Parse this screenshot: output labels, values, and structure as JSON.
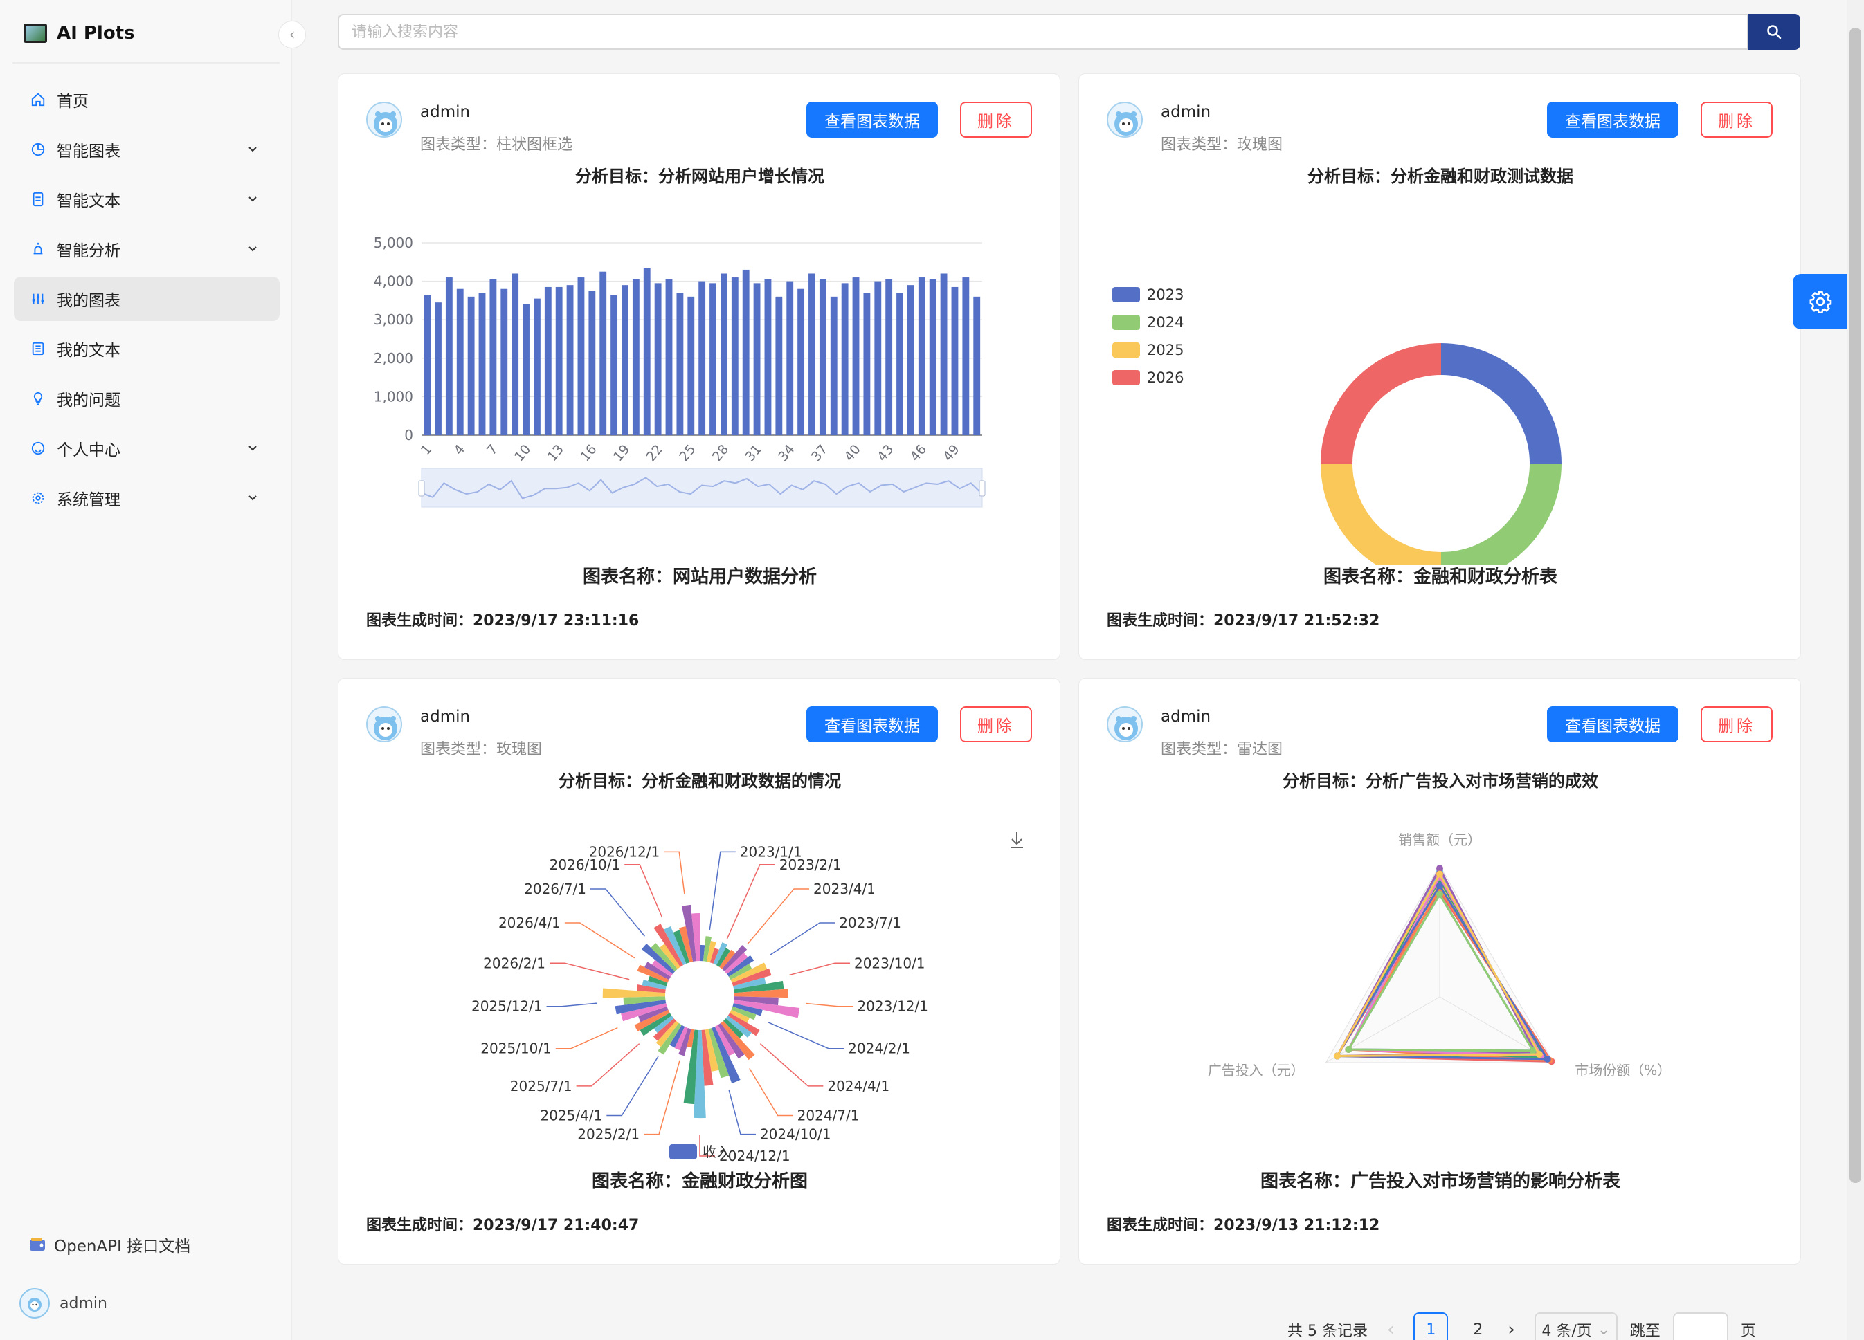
{
  "app": {
    "title": "AI Plots"
  },
  "sidebar": {
    "items": [
      {
        "label": "首页",
        "icon": "home-icon",
        "expandable": false,
        "active": false
      },
      {
        "label": "智能图表",
        "icon": "chart-pie-icon",
        "expandable": true,
        "active": false
      },
      {
        "label": "智能文本",
        "icon": "document-icon",
        "expandable": true,
        "active": false
      },
      {
        "label": "智能分析",
        "icon": "alarm-icon",
        "expandable": true,
        "active": false
      },
      {
        "label": "我的图表",
        "icon": "sliders-icon",
        "expandable": false,
        "active": true
      },
      {
        "label": "我的文本",
        "icon": "list-icon",
        "expandable": false,
        "active": false
      },
      {
        "label": "我的问题",
        "icon": "bulb-icon",
        "expandable": false,
        "active": false
      },
      {
        "label": "个人中心",
        "icon": "smile-icon",
        "expandable": true,
        "active": false
      },
      {
        "label": "系统管理",
        "icon": "gear-icon",
        "expandable": true,
        "active": false
      }
    ],
    "openapi_label": "OpenAPI 接口文档",
    "user": "admin"
  },
  "search": {
    "placeholder": "请输入搜索内容"
  },
  "cards": [
    {
      "user": "admin",
      "type": "图表类型：柱状图框选",
      "goal": "分析目标：分析网站用户增长情况",
      "view_label": "查看图表数据",
      "delete_label": "删除",
      "chart_name": "图表名称：网站用户数据分析",
      "time": "图表生成时间：2023/9/17 23:11:16"
    },
    {
      "user": "admin",
      "type": "图表类型：玫瑰图",
      "goal": "分析目标：分析金融和财政测试数据",
      "view_label": "查看图表数据",
      "delete_label": "删除",
      "chart_name": "图表名称：金融和财政分析表",
      "time": "图表生成时间：2023/9/17 21:52:32"
    },
    {
      "user": "admin",
      "type": "图表类型：玫瑰图",
      "goal": "分析目标：分析金融和财政数据的情况",
      "view_label": "查看图表数据",
      "delete_label": "删除",
      "chart_name": "图表名称：金融财政分析图",
      "time": "图表生成时间：2023/9/17 21:40:47"
    },
    {
      "user": "admin",
      "type": "图表类型：雷达图",
      "goal": "分析目标：分析广告投入对市场营销的成效",
      "view_label": "查看图表数据",
      "delete_label": "删除",
      "chart_name": "图表名称：广告投入对市场营销的影响分析表",
      "time": "图表生成时间：2023/9/13 21:12:12"
    }
  ],
  "pagination": {
    "total_label": "共 5 条记录",
    "pages": [
      "1",
      "2"
    ],
    "current": "1",
    "page_size": "4 条/页",
    "jump_label": "跳至",
    "page_suffix": "页"
  },
  "colors": {
    "primary": "#1677ff",
    "danger": "#ff4d4f",
    "search_button": "#1f3b87",
    "bar": "#5470c6"
  },
  "chart_data": [
    {
      "type": "bar",
      "x": [
        1,
        2,
        3,
        4,
        5,
        6,
        7,
        8,
        9,
        10,
        11,
        12,
        13,
        14,
        15,
        16,
        17,
        18,
        19,
        20,
        21,
        22,
        23,
        24,
        25,
        26,
        27,
        28,
        29,
        30,
        31,
        32,
        33,
        34,
        35,
        36,
        37,
        38,
        39,
        40,
        41,
        42,
        43,
        44,
        45,
        46,
        47,
        48,
        49,
        50
      ],
      "x_tick_labels": [
        "1",
        "4",
        "7",
        "10",
        "13",
        "16",
        "19",
        "22",
        "25",
        "28",
        "31",
        "34",
        "37",
        "40",
        "43",
        "46",
        "49"
      ],
      "values": [
        3650,
        3450,
        4100,
        3800,
        3600,
        3700,
        4050,
        3800,
        4200,
        3400,
        3550,
        3850,
        3850,
        3900,
        4100,
        3750,
        4250,
        3650,
        3900,
        4050,
        4350,
        3950,
        4050,
        3700,
        3600,
        4000,
        3950,
        4200,
        4100,
        4300,
        3950,
        4050,
        3600,
        4000,
        3800,
        4200,
        4050,
        3600,
        3950,
        4100,
        3700,
        4000,
        4050,
        3700,
        3900,
        4100,
        4050,
        4200,
        3850,
        4100,
        3600
      ],
      "yticks": [
        0,
        1000,
        2000,
        3000,
        4000,
        5000
      ],
      "ytick_labels": [
        "0",
        "1,000",
        "2,000",
        "3,000",
        "4,000",
        "5,000"
      ],
      "ylim": [
        0,
        5000
      ],
      "color": "#5470c6",
      "has_data_zoom": true
    },
    {
      "type": "pie",
      "variant": "donut",
      "legend": [
        "2023",
        "2024",
        "2025",
        "2026"
      ],
      "legend_position": "top-left",
      "values": [
        25,
        25,
        25,
        25
      ],
      "colors": [
        "#5470c6",
        "#91cc75",
        "#fac858",
        "#ee6666"
      ]
    },
    {
      "type": "pie",
      "variant": "rose",
      "legend": [
        "收入"
      ],
      "labels": [
        "2023/1/1",
        "2023/2/1",
        "2023/4/1",
        "2023/7/1",
        "2023/10/1",
        "2023/12/1",
        "2024/2/1",
        "2024/4/1",
        "2024/7/1",
        "2024/10/1",
        "2024/12/1",
        "2025/2/1",
        "2025/4/1",
        "2025/7/1",
        "2025/10/1",
        "2025/12/1",
        "2026/2/1",
        "2026/4/1",
        "2026/7/1",
        "2026/10/1",
        "2026/12/1"
      ],
      "values": [
        40,
        35,
        45,
        60,
        75,
        95,
        50,
        55,
        70,
        85,
        140,
        42,
        50,
        55,
        70,
        90,
        48,
        52,
        60,
        68,
        90
      ],
      "colors": [
        "#5470c6",
        "#91cc75",
        "#fac858",
        "#ee6666",
        "#73c0de",
        "#3ba272",
        "#fc8452",
        "#9a60b4",
        "#ea7ccc"
      ]
    },
    {
      "type": "radar",
      "indicators": [
        "销售额（元）",
        "市场份额（%）",
        "广告投入（元）"
      ],
      "series_count": 12,
      "colors": [
        "#5470c6",
        "#91cc75",
        "#fac858",
        "#ee6666",
        "#73c0de",
        "#3ba272",
        "#fc8452",
        "#9a60b4",
        "#ea7ccc"
      ]
    }
  ]
}
